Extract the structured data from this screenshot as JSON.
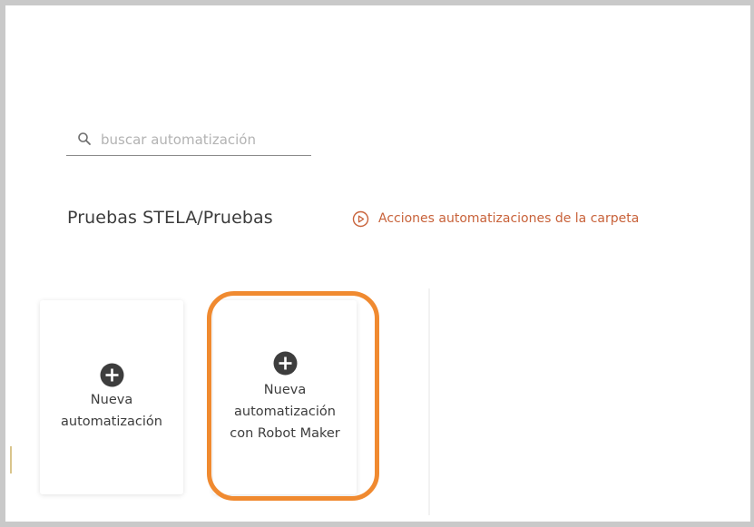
{
  "search": {
    "placeholder": "buscar automatización",
    "value": ""
  },
  "folder": {
    "title": "Pruebas STELA/Pruebas",
    "actions_label": "Acciones automatizaciones de la carpeta",
    "actions_color": "#c8623a"
  },
  "cards": [
    {
      "label": "Nueva automatización",
      "icon": "plus-circle-icon"
    },
    {
      "label": "Nueva automatización con Robot Maker",
      "icon": "plus-circle-icon"
    }
  ],
  "highlight": {
    "color": "#f08a30"
  }
}
